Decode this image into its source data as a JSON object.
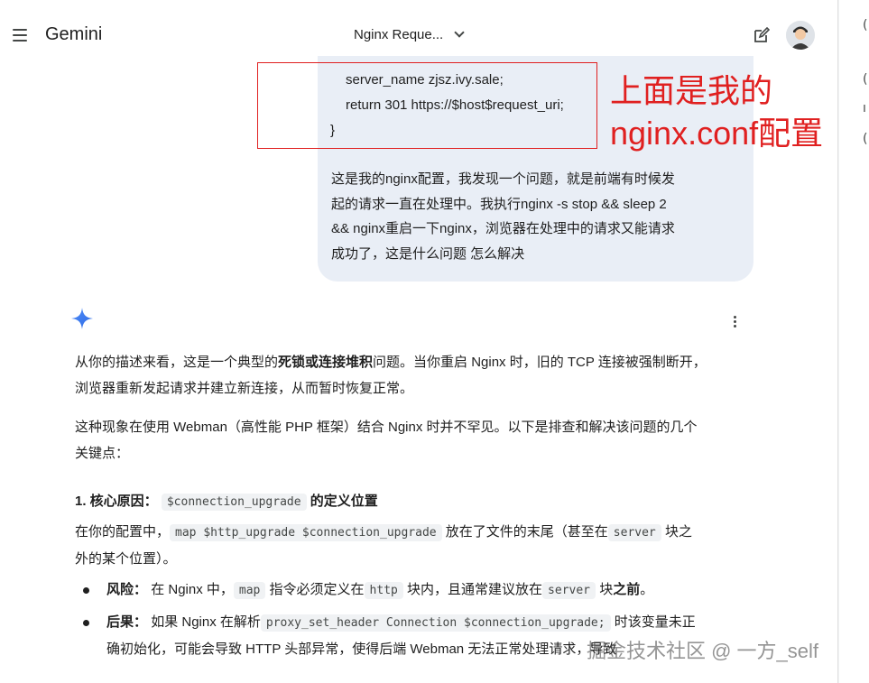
{
  "header": {
    "brand": "Gemini",
    "conversation_title": "Nginx Reque..."
  },
  "user_message": {
    "code_lines": [
      "server_name zjsz.ivy.sale;",
      "return 301 https://$host$request_uri;",
      "}"
    ],
    "text_lines": [
      "这是我的nginx配置，我发现一个问题，就是前端有时候发",
      "起的请求一直在处理中。我执行nginx -s stop && sleep 2",
      "&& nginx重启一下nginx，浏览器在处理中的请求又能请求",
      "成功了，这是什么问题 怎么解决"
    ]
  },
  "annotation": {
    "line1": "上面是我的",
    "line2": "nginx.conf配置"
  },
  "response": {
    "p1": {
      "a": "从你的描述来看，这是一个典型的",
      "bold": "死锁或连接堆积",
      "b": "问题。当你重启 Nginx 时，旧的 TCP 连接被强制断开，",
      "line2": "浏览器重新发起请求并建立新连接，从而暂时恢复正常。"
    },
    "p2": {
      "line1": "这种现象在使用 Webman（高性能 PHP 框架）结合 Nginx 时并不罕见。以下是排查和解决该问题的几个",
      "line2": "关键点："
    },
    "section1": {
      "prefix": "1. 核心原因：",
      "code": "$connection_upgrade",
      "suffix": "的定义位置"
    },
    "p3": {
      "a": "在你的配置中，",
      "code1": "map $http_upgrade $connection_upgrade",
      "b": "放在了文件的末尾（甚至在",
      "code2": "server",
      "c": "块之",
      "line2": "外的某个位置）。"
    },
    "bullet1": {
      "label": "风险：",
      "a": "在 Nginx 中，",
      "code1": "map",
      "b": "指令必须定义在",
      "code2": "http",
      "c": "块内，且通常建议放在",
      "code3": "server",
      "d": "块",
      "bold_end": "之前",
      "e": "。"
    },
    "bullet2": {
      "label": "后果：",
      "a": "如果 Nginx 在解析",
      "code1": "proxy_set_header Connection $connection_upgrade;",
      "b": "时该变量未正",
      "line2": "确初始化，可能会导致 HTTP 头部异常，使得后端 Webman 无法正常处理请求，导致"
    }
  },
  "watermark": "掘金技术社区 @ 一方_self",
  "colors": {
    "bubble": "#e9eef6",
    "annotation": "#e02020",
    "sparkle": "#4285f4",
    "code_bg": "#f0f2f4"
  },
  "icons": [
    "menu-icon",
    "chevron-down-icon",
    "edit-icon",
    "avatar",
    "sparkle-icon",
    "more-vert-icon"
  ]
}
